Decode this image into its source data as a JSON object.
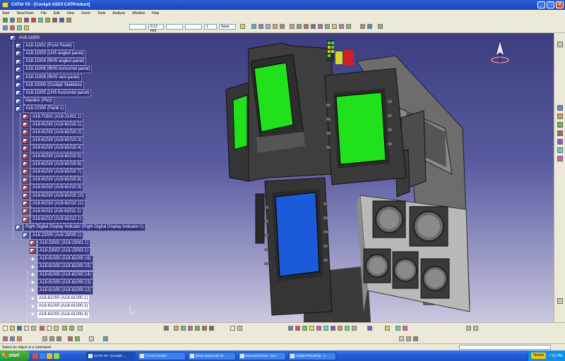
{
  "window": {
    "title": "CATIA V5 - [Cockpit ASSY.CATProduct]"
  },
  "menu": [
    "Start",
    "SmarTeam",
    "File",
    "Edit",
    "View",
    "Insert",
    "Tools",
    "Analyze",
    "Window",
    "Help"
  ],
  "toolbar": {
    "line_thickness": "0.13 mm",
    "layer": "None",
    "line_type": "1"
  },
  "tree": [
    {
      "label": "A18-11000",
      "icon": "product",
      "style": "plain"
    },
    {
      "label": "A18-11001 (Front Panel)",
      "icon": "product",
      "style": "sel"
    },
    {
      "label": "A18-11003 (LHS angled panel)",
      "icon": "product",
      "style": "sel"
    },
    {
      "label": "A18-11004 (RHS angled panel)",
      "icon": "product",
      "style": "sel"
    },
    {
      "label": "A18-11006 (RHS horizontal panel)",
      "icon": "product",
      "style": "sel"
    },
    {
      "label": "A18-11008 (RHS vent panel)",
      "icon": "product",
      "style": "sel"
    },
    {
      "label": "A18-10000 (Cockpit Skeleton)",
      "icon": "product",
      "style": "sel"
    },
    {
      "label": "A18-11005 (LHS horizontal panel)",
      "icon": "product",
      "style": "sel"
    },
    {
      "label": "Manikin (Pilot)",
      "icon": "product",
      "style": "sel"
    },
    {
      "label": "A18-21500 (Part6.1)",
      "icon": "product",
      "style": "sel"
    },
    {
      "label": "A18-71601 (A18-21401.1)",
      "icon": "part",
      "style": "sel"
    },
    {
      "label": "A18-61010 (A18-61010.1)",
      "icon": "part",
      "style": "sel"
    },
    {
      "label": "A18-61010 (A18-61010.2)",
      "icon": "part",
      "style": "sel"
    },
    {
      "label": "A18-61010 (A18-61010.3)",
      "icon": "part",
      "style": "sel"
    },
    {
      "label": "A18-61010 (A18-61010.4)",
      "icon": "part",
      "style": "sel"
    },
    {
      "label": "A18-61010 (A18-61010.5)",
      "icon": "part",
      "style": "sel"
    },
    {
      "label": "A18-61010 (A18-61010.6)",
      "icon": "part",
      "style": "sel"
    },
    {
      "label": "A18-61010 (A18-61010.7)",
      "icon": "part",
      "style": "sel"
    },
    {
      "label": "A18-61010 (A18-61010.8)",
      "icon": "part",
      "style": "sel"
    },
    {
      "label": "A18-61010 (A18-61010.9)",
      "icon": "part",
      "style": "sel"
    },
    {
      "label": "A18-61010 (A18-61010.10)",
      "icon": "part",
      "style": "sel"
    },
    {
      "label": "A18-61010 (A18-61010.11)",
      "icon": "part",
      "style": "sel"
    },
    {
      "label": "A18-61011 (A18-61011.1)",
      "icon": "part",
      "style": "sel"
    },
    {
      "label": "A18-61012 (A18-61012.1)",
      "icon": "part",
      "style": "sel"
    },
    {
      "label": "Right Digital Display Indicator (Right Digital Display Indicator.1)",
      "icon": "product",
      "style": "sel"
    },
    {
      "label": "A18-23000 (A18-23000.1)",
      "icon": "product",
      "style": "sel"
    },
    {
      "label": "A18-23001 (A18-23001.1)",
      "icon": "part",
      "style": "sel"
    },
    {
      "label": "A18-23002 (A18-23002.1)",
      "icon": "part",
      "style": "sel"
    },
    {
      "label": "A18-61000 (A18-61000.16)",
      "icon": "star",
      "style": "sel"
    },
    {
      "label": "A18-61000 (A18-61000.15)",
      "icon": "star",
      "style": "sel"
    },
    {
      "label": "A18-61000 (A18-61000.14)",
      "icon": "star",
      "style": "sel"
    },
    {
      "label": "A18-61000 (A18-61000.13)",
      "icon": "star",
      "style": "sel"
    },
    {
      "label": "A18-61000 (A18-61000.12)",
      "icon": "star",
      "style": "sel"
    },
    {
      "label": "A18-61000 (A18-61000.1)",
      "icon": "star",
      "style": "inverse"
    },
    {
      "label": "A18-61000 (A18-61000.2)",
      "icon": "star",
      "style": "inverse"
    },
    {
      "label": "A18-61000 (A18-61000.3)",
      "icon": "star",
      "style": "inverse"
    }
  ],
  "status": {
    "message": "Select an object or a command"
  },
  "taskbar": {
    "start": "start",
    "tasks": [
      "CATIA V5 - [Cockpit ...",
      "F:\\A18 Cockpit",
      "photo-supersonic-D...",
      "Microsoft Excel - Coc...",
      "Adobe Photoshop - [..."
    ],
    "norton": "Norton",
    "clock": "7:15 PM"
  }
}
